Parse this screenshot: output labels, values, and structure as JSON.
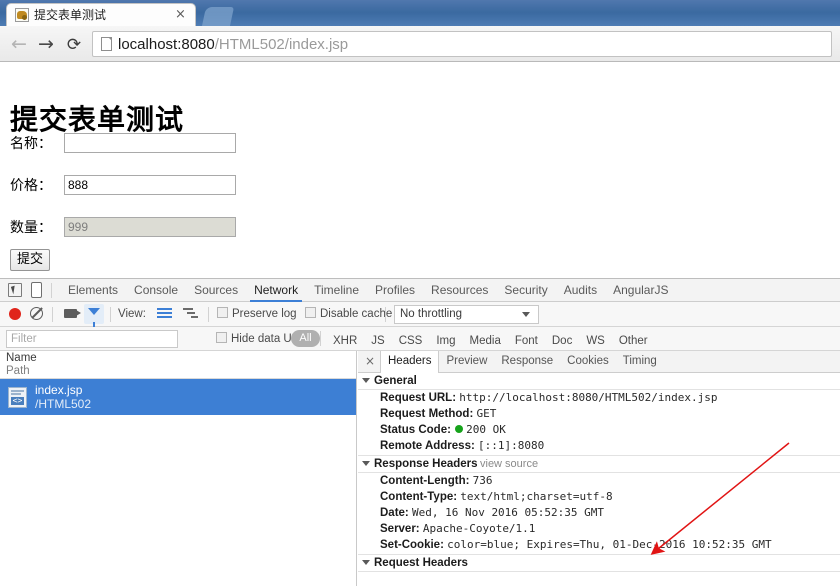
{
  "browser": {
    "tab": {
      "title": "提交表单测试",
      "favicon": "tomcat-favicon",
      "close_label": "×"
    },
    "nav": {
      "back": "←",
      "forward": "→",
      "reload": "⟳"
    },
    "omnibox": {
      "url_scheme_host": "localhost:8080",
      "url_path": "/HTML502/index.jsp",
      "page_icon": "page-icon"
    }
  },
  "page": {
    "heading": "提交表单测试",
    "fields": [
      {
        "label": "名称：",
        "value": "",
        "disabled": false,
        "name": "name"
      },
      {
        "label": "价格：",
        "value": "888",
        "disabled": false,
        "name": "price"
      },
      {
        "label": "数量：",
        "value": "999",
        "disabled": true,
        "name": "quantity"
      }
    ],
    "submit_label": "提交"
  },
  "devtools": {
    "panel_tabs": [
      {
        "label": "Elements",
        "active": false
      },
      {
        "label": "Console",
        "active": false
      },
      {
        "label": "Sources",
        "active": false
      },
      {
        "label": "Network",
        "active": true
      },
      {
        "label": "Timeline",
        "active": false
      },
      {
        "label": "Profiles",
        "active": false
      },
      {
        "label": "Resources",
        "active": false
      },
      {
        "label": "Security",
        "active": false
      },
      {
        "label": "Audits",
        "active": false
      },
      {
        "label": "AngularJS",
        "active": false
      }
    ],
    "toolbar": {
      "view_label": "View:",
      "preserve_log": "Preserve log",
      "disable_cache": "Disable cache",
      "throttling": "No throttling"
    },
    "filterbar": {
      "filter_placeholder": "Filter",
      "hide_data_urls": "Hide data URLs",
      "all_pill": "All",
      "types": [
        "XHR",
        "JS",
        "CSS",
        "Img",
        "Media",
        "Font",
        "Doc",
        "WS",
        "Other"
      ]
    },
    "network_list": {
      "col_name": "Name",
      "col_path": "Path",
      "rows": [
        {
          "name": "index.jsp",
          "path": "/HTML502",
          "selected": true
        }
      ]
    },
    "detail": {
      "tabs": [
        {
          "label": "Headers",
          "active": true
        },
        {
          "label": "Preview",
          "active": false
        },
        {
          "label": "Response",
          "active": false
        },
        {
          "label": "Cookies",
          "active": false
        },
        {
          "label": "Timing",
          "active": false
        }
      ],
      "close_label": "×",
      "sections": [
        {
          "title": "General",
          "view_source": "",
          "rows": [
            {
              "name": "Request URL:",
              "value": "http://localhost:8080/HTML502/index.jsp"
            },
            {
              "name": "Request Method:",
              "value": "GET"
            },
            {
              "name": "Status Code:",
              "value": "200 OK",
              "status_dot": true
            },
            {
              "name": "Remote Address:",
              "value": "[::1]:8080"
            }
          ]
        },
        {
          "title": "Response Headers",
          "view_source": "view source",
          "rows": [
            {
              "name": "Content-Length:",
              "value": "736"
            },
            {
              "name": "Content-Type:",
              "value": "text/html;charset=utf-8"
            },
            {
              "name": "Date:",
              "value": "Wed, 16 Nov 2016 05:52:35 GMT"
            },
            {
              "name": "Server:",
              "value": "Apache-Coyote/1.1"
            },
            {
              "name": "Set-Cookie:",
              "value": "color=blue; Expires=Thu, 01-Dec-2016 10:52:35 GMT"
            }
          ]
        },
        {
          "title": "Request Headers",
          "view_source": "",
          "rows": []
        }
      ]
    }
  },
  "annotation": {
    "arrow_color": "#e11414"
  }
}
